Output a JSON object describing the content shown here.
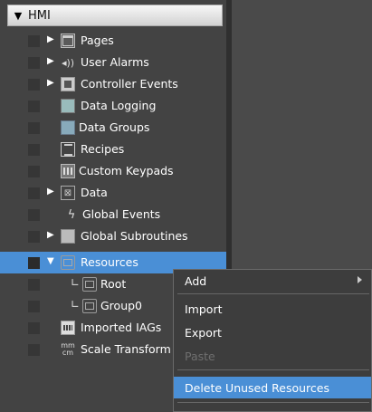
{
  "tree": {
    "root_label": "HMI",
    "items": [
      {
        "label": "Pages",
        "expand": "▶",
        "icon": "pages-icon"
      },
      {
        "label": "User Alarms",
        "expand": "▶",
        "icon": "speaker-icon",
        "glyph": "◂))"
      },
      {
        "label": "Controller Events",
        "expand": "▶",
        "icon": "controller-events-icon"
      },
      {
        "label": "Data Logging",
        "expand": "",
        "icon": "data-logging-icon"
      },
      {
        "label": "Data Groups",
        "expand": "",
        "icon": "data-groups-icon"
      },
      {
        "label": "Recipes",
        "expand": "",
        "icon": "recipes-icon"
      },
      {
        "label": "Custom Keypads",
        "expand": "",
        "icon": "keypad-icon"
      },
      {
        "label": "Data",
        "expand": "▶",
        "icon": "data-icon",
        "glyph": "⊠"
      },
      {
        "label": "Global Events",
        "expand": "",
        "icon": "lightning-icon",
        "glyph": "ϟ"
      },
      {
        "label": "Global Subroutines",
        "expand": "▶",
        "icon": "subroutine-icon"
      },
      {
        "label": "Resources",
        "expand": "▼",
        "icon": "resource-folder-icon"
      },
      {
        "label": "Root",
        "corner": "∟",
        "icon": "resource-folder-icon"
      },
      {
        "label": "Group0",
        "corner": "∟",
        "icon": "resource-folder-icon"
      },
      {
        "label": "Imported IAGs",
        "expand": "",
        "icon": "iag-icon"
      },
      {
        "label": "Scale Transform",
        "expand": "",
        "icon": "scale-transform-icon",
        "glyph_top": "mm",
        "glyph_bottom": "cm"
      }
    ]
  },
  "context_menu": {
    "add": "Add",
    "import": "Import",
    "export": "Export",
    "paste": "Paste",
    "delete_unused": "Delete Unused Resources"
  },
  "colors": {
    "panel_bg": "#434343",
    "selection": "#4a8fd6",
    "menu_bg": "#3d3d3d",
    "disabled_text": "#6f6f6f"
  }
}
